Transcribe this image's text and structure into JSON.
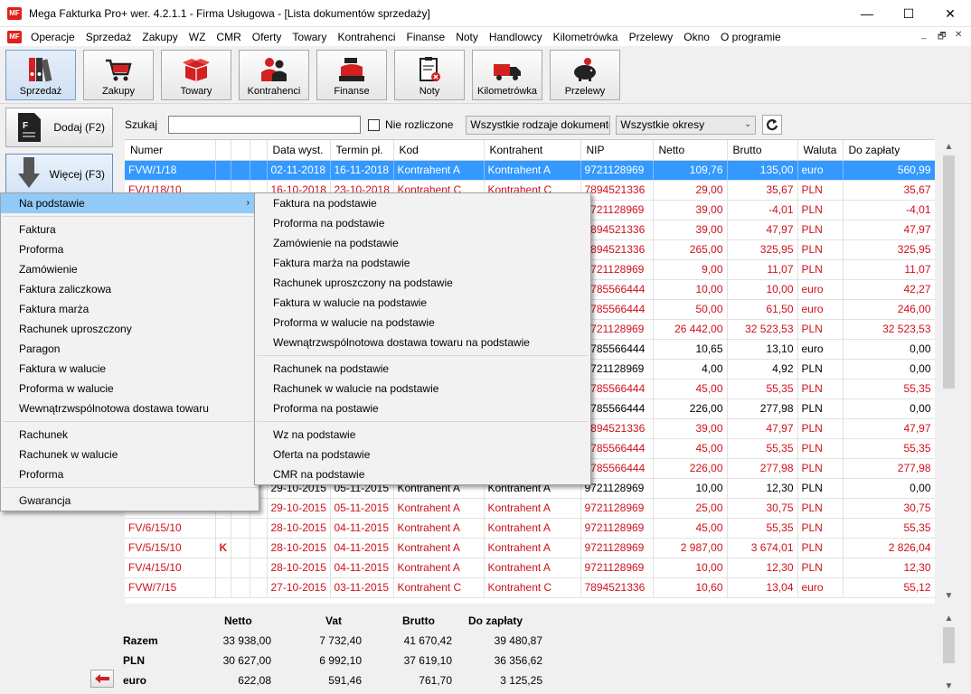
{
  "window": {
    "title": "Mega Fakturka Pro+ wer. 4.2.1.1 - Firma Usługowa - [Lista dokumentów sprzedaży]",
    "logo": "MF",
    "minimize": "—",
    "maximize": "☐",
    "close": "✕"
  },
  "menubar": {
    "items": [
      "Operacje",
      "Sprzedaż",
      "Zakupy",
      "WZ",
      "CMR",
      "Oferty",
      "Towary",
      "Kontrahenci",
      "Finanse",
      "Noty",
      "Handlowcy",
      "Kilometrówka",
      "Przelewy",
      "Okno",
      "O programie"
    ],
    "mdi_min": "_",
    "mdi_restore": "🗗",
    "mdi_close": "✕"
  },
  "toolbar": {
    "buttons": [
      "Sprzedaż",
      "Zakupy",
      "Towary",
      "Kontrahenci",
      "Finanse",
      "Noty",
      "Kilometrówka",
      "Przelewy"
    ]
  },
  "side": {
    "add": "Dodaj (F2)",
    "more": "Więcej (F3)"
  },
  "search": {
    "label": "Szukaj",
    "value": "",
    "unsettled_label": "Nie rozliczone",
    "doc_type": "Wszystkie rodzaje dokumentó",
    "period": "Wszystkie okresy"
  },
  "grid": {
    "columns": [
      "Numer",
      "",
      "",
      "",
      "Data wyst.",
      "Termin pł.",
      "Kod",
      "Kontrahent",
      "NIP",
      "Netto",
      "Brutto",
      "Waluta",
      "Do zapłaty"
    ],
    "rows": [
      {
        "numer": "FVW/1/18",
        "flag": "",
        "date": "02-11-2018",
        "due": "16-11-2018",
        "kod": "Kontrahent A",
        "kontr": "Kontrahent A",
        "nip": "9721128969",
        "netto": "109,76",
        "brutto": "135,00",
        "waluta": "euro",
        "dozap": "560,99"
      },
      {
        "numer": "FV/1/18/10",
        "flag": "",
        "date": "16-10-2018",
        "due": "23-10-2018",
        "kod": "Kontrahent C",
        "kontr": "Kontrahent C",
        "nip": "7894521336",
        "netto": "29,00",
        "brutto": "35,67",
        "waluta": "PLN",
        "dozap": "35,67"
      },
      {
        "numer": "",
        "flag": "",
        "date": "",
        "due": "",
        "kod": "",
        "kontr": "",
        "nip": "9721128969",
        "netto": "39,00",
        "brutto": "-4,01",
        "waluta": "PLN",
        "dozap": "-4,01"
      },
      {
        "numer": "",
        "flag": "",
        "date": "",
        "due": "",
        "kod": "",
        "kontr": "",
        "nip": "7894521336",
        "netto": "39,00",
        "brutto": "47,97",
        "waluta": "PLN",
        "dozap": "47,97"
      },
      {
        "numer": "",
        "flag": "",
        "date": "",
        "due": "",
        "kod": "",
        "kontr": "",
        "nip": "7894521336",
        "netto": "265,00",
        "brutto": "325,95",
        "waluta": "PLN",
        "dozap": "325,95"
      },
      {
        "numer": "",
        "flag": "",
        "date": "",
        "due": "",
        "kod": "",
        "kontr": "",
        "nip": "9721128969",
        "netto": "9,00",
        "brutto": "11,07",
        "waluta": "PLN",
        "dozap": "11,07"
      },
      {
        "numer": "",
        "flag": "",
        "date": "",
        "due": "",
        "kod": "",
        "kontr": "",
        "nip": "9785566444",
        "netto": "10,00",
        "brutto": "10,00",
        "waluta": "euro",
        "dozap": "42,27"
      },
      {
        "numer": "",
        "flag": "",
        "date": "",
        "due": "",
        "kod": "",
        "kontr": "",
        "nip": "9785566444",
        "netto": "50,00",
        "brutto": "61,50",
        "waluta": "euro",
        "dozap": "246,00"
      },
      {
        "numer": "",
        "flag": "",
        "date": "",
        "due": "",
        "kod": "",
        "kontr": "",
        "nip": "9721128969",
        "netto": "26 442,00",
        "brutto": "32 523,53",
        "waluta": "PLN",
        "dozap": "32 523,53"
      },
      {
        "numer": "",
        "flag": "",
        "date": "",
        "due": "",
        "kod": "",
        "kontr": "",
        "nip": "9785566444",
        "netto": "10,65",
        "brutto": "13,10",
        "waluta": "euro",
        "dozap": "0,00",
        "dark": true
      },
      {
        "numer": "",
        "flag": "",
        "date": "",
        "due": "",
        "kod": "",
        "kontr": "",
        "nip": "9721128969",
        "netto": "4,00",
        "brutto": "4,92",
        "waluta": "PLN",
        "dozap": "0,00",
        "dark": true
      },
      {
        "numer": "",
        "flag": "",
        "date": "",
        "due": "",
        "kod": "",
        "kontr": "",
        "nip": "9785566444",
        "netto": "45,00",
        "brutto": "55,35",
        "waluta": "PLN",
        "dozap": "55,35"
      },
      {
        "numer": "",
        "flag": "",
        "date": "",
        "due": "",
        "kod": "",
        "kontr": "",
        "nip": "9785566444",
        "netto": "226,00",
        "brutto": "277,98",
        "waluta": "PLN",
        "dozap": "0,00",
        "dark": true
      },
      {
        "numer": "",
        "flag": "",
        "date": "",
        "due": "",
        "kod": "",
        "kontr": "",
        "nip": "7894521336",
        "netto": "39,00",
        "brutto": "47,97",
        "waluta": "PLN",
        "dozap": "47,97"
      },
      {
        "numer": "",
        "flag": "",
        "date": "",
        "due": "",
        "kod": "",
        "kontr": "",
        "nip": "9785566444",
        "netto": "45,00",
        "brutto": "55,35",
        "waluta": "PLN",
        "dozap": "55,35"
      },
      {
        "numer": "",
        "flag": "",
        "date": "",
        "due": "",
        "kod": "",
        "kontr": "",
        "nip": "9785566444",
        "netto": "226,00",
        "brutto": "277,98",
        "waluta": "PLN",
        "dozap": "277,98"
      },
      {
        "numer": "",
        "flag": "",
        "date": "29-10-2015",
        "due": "05-11-2015",
        "kod": "Kontrahent A",
        "kontr": "Kontrahent A",
        "nip": "9721128969",
        "netto": "10,00",
        "brutto": "12,30",
        "waluta": "PLN",
        "dozap": "0,00",
        "dark": true
      },
      {
        "numer": "",
        "flag": "",
        "date": "29-10-2015",
        "due": "05-11-2015",
        "kod": "Kontrahent A",
        "kontr": "Kontrahent A",
        "nip": "9721128969",
        "netto": "25,00",
        "brutto": "30,75",
        "waluta": "PLN",
        "dozap": "30,75"
      },
      {
        "numer": "FV/6/15/10",
        "flag": "",
        "date": "28-10-2015",
        "due": "04-11-2015",
        "kod": "Kontrahent A",
        "kontr": "Kontrahent A",
        "nip": "9721128969",
        "netto": "45,00",
        "brutto": "55,35",
        "waluta": "PLN",
        "dozap": "55,35"
      },
      {
        "numer": "FV/5/15/10",
        "flag": "K",
        "date": "28-10-2015",
        "due": "04-11-2015",
        "kod": "Kontrahent A",
        "kontr": "Kontrahent A",
        "nip": "9721128969",
        "netto": "2 987,00",
        "brutto": "3 674,01",
        "waluta": "PLN",
        "dozap": "2 826,04"
      },
      {
        "numer": "FV/4/15/10",
        "flag": "",
        "date": "28-10-2015",
        "due": "04-11-2015",
        "kod": "Kontrahent A",
        "kontr": "Kontrahent A",
        "nip": "9721128969",
        "netto": "10,00",
        "brutto": "12,30",
        "waluta": "PLN",
        "dozap": "12,30"
      },
      {
        "numer": "FVW/7/15",
        "flag": "",
        "date": "27-10-2015",
        "due": "03-11-2015",
        "kod": "Kontrahent C",
        "kontr": "Kontrahent C",
        "nip": "7894521336",
        "netto": "10,60",
        "brutto": "13,04",
        "waluta": "euro",
        "dozap": "55,12"
      }
    ]
  },
  "summary": {
    "headers": [
      "Netto",
      "Vat",
      "Brutto",
      "Do zapłaty"
    ],
    "rows": [
      {
        "label": "Razem",
        "netto": "33 938,00",
        "vat": "7 732,40",
        "brutto": "41 670,42",
        "dozap": "39 480,87"
      },
      {
        "label": "PLN",
        "netto": "30 627,00",
        "vat": "6 992,10",
        "brutto": "37 619,10",
        "dozap": "36 356,62"
      },
      {
        "label": "euro",
        "netto": "622,08",
        "vat": "591,46",
        "brutto": "761,70",
        "dozap": "3 125,25"
      }
    ]
  },
  "menu_main": {
    "items": [
      {
        "label": "Na podstawie",
        "submenu": true,
        "hl": true
      },
      {
        "sep": true
      },
      {
        "label": "Faktura"
      },
      {
        "label": "Proforma"
      },
      {
        "label": "Zamówienie"
      },
      {
        "label": "Faktura zaliczkowa"
      },
      {
        "label": "Faktura marża"
      },
      {
        "label": "Rachunek uproszczony"
      },
      {
        "label": "Paragon"
      },
      {
        "label": "Faktura w walucie"
      },
      {
        "label": "Proforma w walucie"
      },
      {
        "label": "Wewnątrzwspólnotowa dostawa towaru"
      },
      {
        "sep": true
      },
      {
        "label": "Rachunek"
      },
      {
        "label": "Rachunek w walucie"
      },
      {
        "label": "Proforma"
      },
      {
        "sep": true
      },
      {
        "label": "Gwarancja"
      }
    ]
  },
  "menu_sub": {
    "items": [
      {
        "label": "Faktura na podstawie"
      },
      {
        "label": "Proforma na podstawie"
      },
      {
        "label": "Zamówienie na podstawie"
      },
      {
        "label": "Faktura marża na podstawie"
      },
      {
        "label": "Rachunek uproszczony na podstawie"
      },
      {
        "label": "Faktura w walucie na podstawie"
      },
      {
        "label": "Proforma w walucie na podstawie"
      },
      {
        "label": "Wewnątrzwspólnotowa dostawa towaru na podstawie"
      },
      {
        "sep": true
      },
      {
        "label": "Rachunek na podstawie"
      },
      {
        "label": "Rachunek w walucie na podstawie"
      },
      {
        "label": "Proforma na postawie"
      },
      {
        "sep": true
      },
      {
        "label": "Wz na podstawie"
      },
      {
        "label": "Oferta na podstawie"
      },
      {
        "label": "CMR na podstawie"
      }
    ]
  }
}
